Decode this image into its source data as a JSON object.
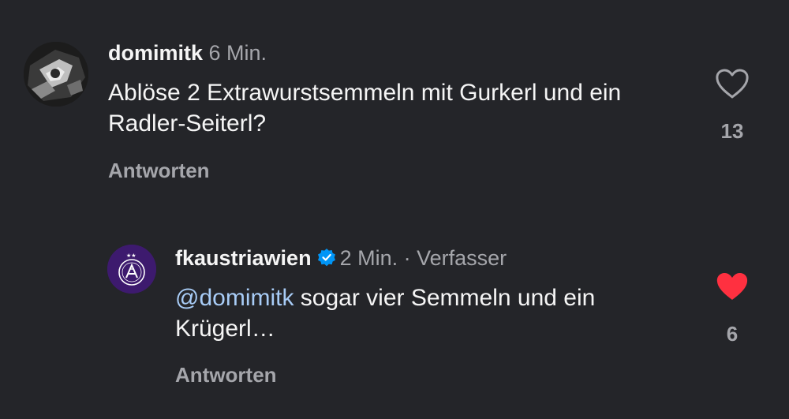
{
  "comments": [
    {
      "username": "domimitk",
      "time": "6 Min.",
      "text": "Ablöse 2 Extrawurstsemmeln mit Gurkerl und ein Radler-Seiterl?",
      "reply_label": "Antworten",
      "likes": "13",
      "liked": false,
      "avatar_icon": "profile-photo"
    },
    {
      "username": "fkaustriawien",
      "verified": true,
      "time": "2 Min.",
      "separator": "·",
      "author_label": "Verfasser",
      "mention": "@domimitk",
      "text": " sogar vier Semmeln und ein Krügerl…",
      "reply_label": "Antworten",
      "likes": "6",
      "liked": true,
      "avatar_icon": "fk-austria-wien-crest"
    }
  ],
  "colors": {
    "background": "#242529",
    "text": "#f5f5f5",
    "muted": "#a5a6ab",
    "mention": "#a8ccf6",
    "verified": "#0095f6",
    "liked_heart": "#ff3040",
    "austria_purple": "#3d1a6e"
  }
}
